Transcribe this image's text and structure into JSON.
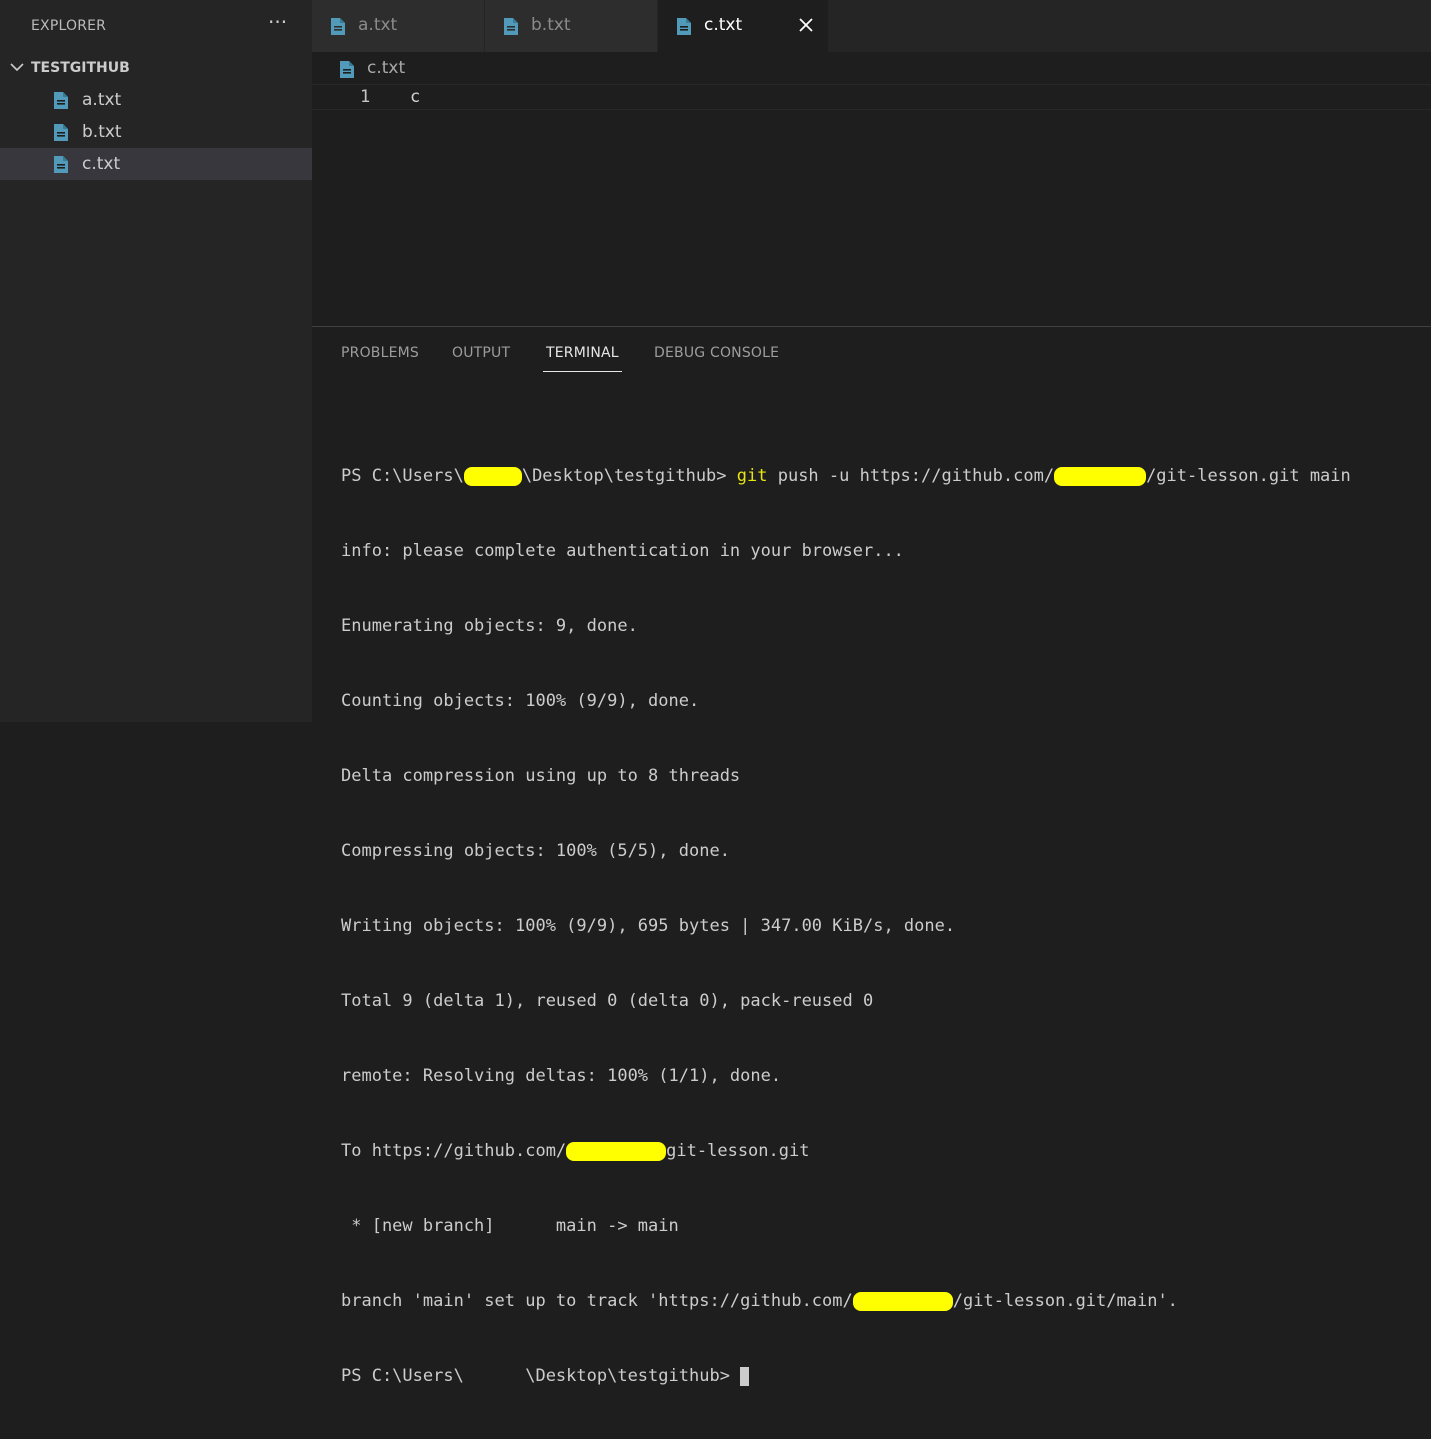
{
  "sidebar": {
    "title": "EXPLORER",
    "more": "···",
    "folder": "TESTGITHUB",
    "files": [
      {
        "label": "a.txt"
      },
      {
        "label": "b.txt"
      },
      {
        "label": "c.txt"
      }
    ]
  },
  "tabs": [
    {
      "label": "a.txt"
    },
    {
      "label": "b.txt"
    },
    {
      "label": "c.txt"
    }
  ],
  "breadcrumb": {
    "file": "c.txt"
  },
  "editor": {
    "line_number": "1",
    "line_text": "c"
  },
  "panel": {
    "tabs": [
      {
        "label": "PROBLEMS"
      },
      {
        "label": "OUTPUT"
      },
      {
        "label": "TERMINAL"
      },
      {
        "label": "DEBUG CONSOLE"
      }
    ]
  },
  "terminal": {
    "line1_prefix": "PS C:\\Users\\",
    "line1_mid": "\\Desktop\\testgithub> ",
    "line1_cmd": "git",
    "line1_args": " push -u https://github.com/",
    "line1_suffix": "/git-lesson.git main",
    "lines": [
      "info: please complete authentication in your browser...",
      "Enumerating objects: 9, done.",
      "Counting objects: 100% (9/9), done.",
      "Delta compression using up to 8 threads",
      "Compressing objects: 100% (5/5), done.",
      "Writing objects: 100% (9/9), 695 bytes | 347.00 KiB/s, done.",
      "Total 9 (delta 1), reused 0 (delta 0), pack-reused 0",
      "remote: Resolving deltas: 100% (1/1), done."
    ],
    "to_prefix": "To https://github.com/",
    "to_suffix": "git-lesson.git",
    "branch_line": " * [new branch]      main -> main",
    "track_prefix": "branch 'main' set up to track 'https://github.com/",
    "track_suffix": "/git-lesson.git/main'.",
    "last_prompt": "PS C:\\Users\\      \\Desktop\\testgithub> "
  },
  "colors": {
    "file_icon": "#519aba",
    "redaction": "#ffff00",
    "git_command": "#e5e510"
  }
}
